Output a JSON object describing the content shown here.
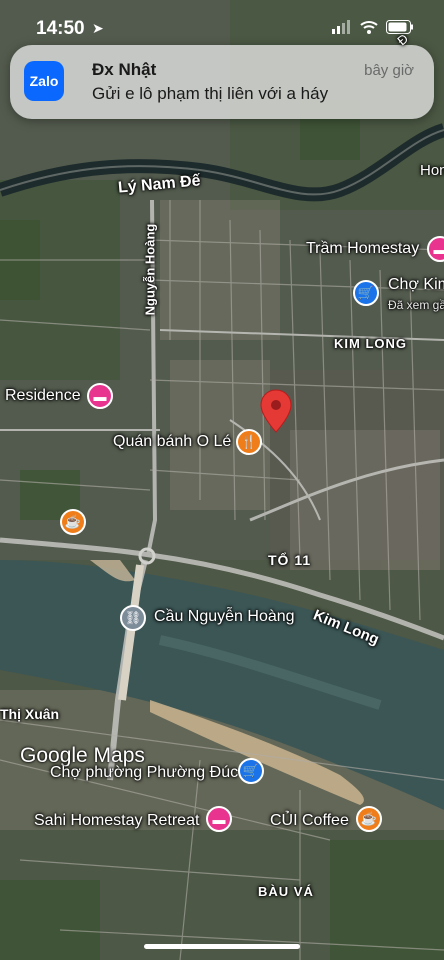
{
  "status_bar": {
    "time": "14:50"
  },
  "notification": {
    "app_icon_text": "Zalo",
    "sender": "Đx Nhật",
    "time_ago": "bây giờ",
    "message": "Gửi e lô phạm thị liên với a háy"
  },
  "map": {
    "brand": "Google Maps",
    "labels": {
      "ly_nam_de": "Lý Nam Đế",
      "nguyen_hoang": "Nguyễn Hoàng",
      "tram_homestay": "Trầm Homestay",
      "cho_kim": "Chợ Kim",
      "da_xem_ga": "Đã xem gầ",
      "kim_long_area": "KIM LONG",
      "residence": "Residence",
      "quan_banh_o_le": "Quán bánh O Lé",
      "to_11": "TỔ 11",
      "cau_nguyen_hoang": "Cầu Nguyễn Hoàng",
      "kim_long_road": "Kim Long",
      "thi_xuan": "Thị Xuân",
      "cho_phuong_phuong_duc": "Chợ phường Phường Đúc",
      "sahi_homestay": "Sahi Homestay Retreat",
      "cui_coffee": "CỦI Coffee",
      "bau_va": "BÀU VÁ",
      "hon": "Hon",
      "d_top": "Đ"
    }
  }
}
